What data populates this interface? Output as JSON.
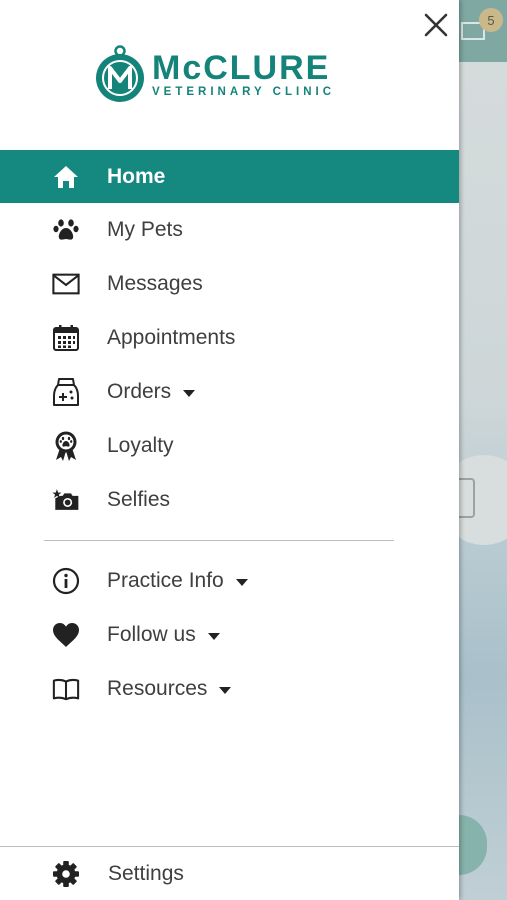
{
  "background": {
    "notification_count": "5",
    "header_color": "#7fa8a3"
  },
  "drawer": {
    "close_icon": "close-icon",
    "logo": {
      "name": "McCLURE",
      "subtitle": "VETERINARY CLINIC",
      "color": "#14837a"
    },
    "menu": [
      {
        "label": "Home",
        "icon": "home-icon",
        "active": true
      },
      {
        "label": "My Pets",
        "icon": "paw-icon"
      },
      {
        "label": "Messages",
        "icon": "envelope-icon"
      },
      {
        "label": "Appointments",
        "icon": "calendar-icon"
      },
      {
        "label": "Orders",
        "icon": "pet-food-bag-icon",
        "has_dropdown": true
      },
      {
        "label": "Loyalty",
        "icon": "award-ribbon-icon"
      },
      {
        "label": "Selfies",
        "icon": "camera-star-icon"
      }
    ],
    "secondary_menu": [
      {
        "label": "Practice Info",
        "icon": "info-icon",
        "has_dropdown": true
      },
      {
        "label": "Follow us",
        "icon": "heart-icon",
        "has_dropdown": true
      },
      {
        "label": "Resources",
        "icon": "book-icon",
        "has_dropdown": true
      }
    ],
    "settings": {
      "label": "Settings",
      "icon": "gear-icon"
    },
    "accent_color": "#15897f"
  }
}
